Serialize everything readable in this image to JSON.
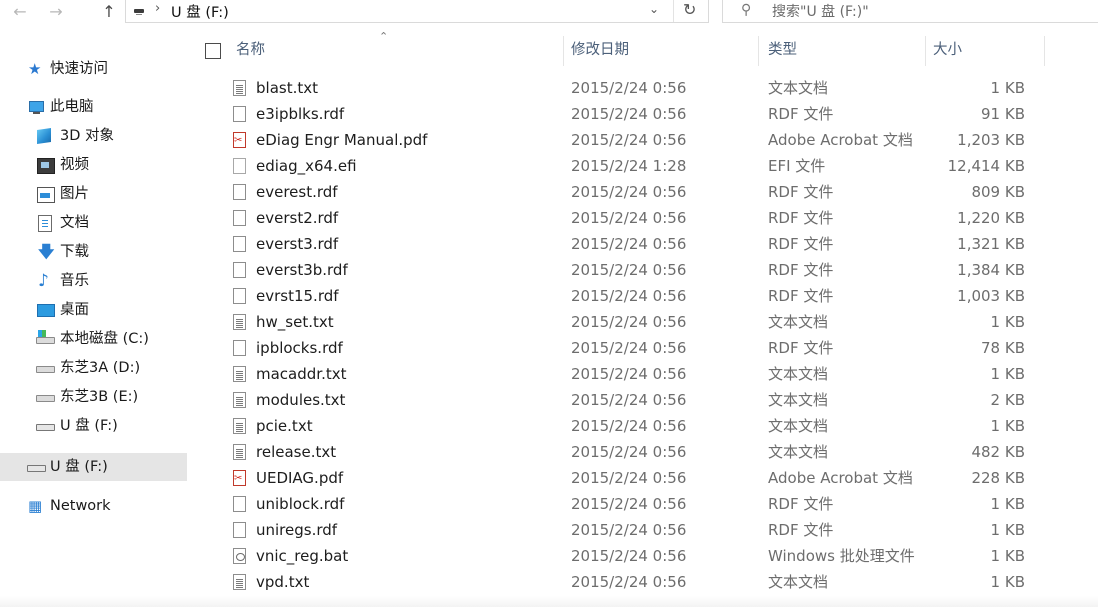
{
  "addressbar": {
    "back_icon": "arrow-left",
    "forward_icon": "arrow-right",
    "up_icon": "arrow-up",
    "separator": "›",
    "path": "U 盘 (F:)",
    "dropdown_icon": "chevron-down",
    "refresh_icon": "refresh"
  },
  "search": {
    "placeholder": "搜索\"U 盘 (F:)\"",
    "icon": "search"
  },
  "sidebar": {
    "quick_access": "快速访问",
    "this_pc": "此电脑",
    "items": [
      {
        "label": "3D 对象",
        "icon": "3d-objects"
      },
      {
        "label": "视频",
        "icon": "video"
      },
      {
        "label": "图片",
        "icon": "pictures"
      },
      {
        "label": "文档",
        "icon": "documents"
      },
      {
        "label": "下载",
        "icon": "downloads"
      },
      {
        "label": "音乐",
        "icon": "music"
      },
      {
        "label": "桌面",
        "icon": "desktop"
      },
      {
        "label": "本地磁盘 (C:)",
        "icon": "system-drive"
      },
      {
        "label": "东芝3A (D:)",
        "icon": "drive"
      },
      {
        "label": "东芝3B (E:)",
        "icon": "drive"
      },
      {
        "label": "U 盘 (F:)",
        "icon": "usb-drive"
      }
    ],
    "selected_drive": "U 盘 (F:)",
    "network": "Network"
  },
  "columns": {
    "name": "名称",
    "modified": "修改日期",
    "type": "类型",
    "size": "大小"
  },
  "files": [
    {
      "name": "blast.txt",
      "modified": "2015/2/24 0:56",
      "type": "文本文档",
      "size": "1 KB",
      "kind": "txt"
    },
    {
      "name": "e3ipblks.rdf",
      "modified": "2015/2/24 0:56",
      "type": "RDF 文件",
      "size": "91 KB",
      "kind": "rdf"
    },
    {
      "name": "eDiag Engr Manual.pdf",
      "modified": "2015/2/24 0:56",
      "type": "Adobe Acrobat 文档",
      "size": "1,203 KB",
      "kind": "pdf"
    },
    {
      "name": "ediag_x64.efi",
      "modified": "2015/2/24 1:28",
      "type": "EFI 文件",
      "size": "12,414 KB",
      "kind": "efi"
    },
    {
      "name": "everest.rdf",
      "modified": "2015/2/24 0:56",
      "type": "RDF 文件",
      "size": "809 KB",
      "kind": "rdf"
    },
    {
      "name": "everst2.rdf",
      "modified": "2015/2/24 0:56",
      "type": "RDF 文件",
      "size": "1,220 KB",
      "kind": "rdf"
    },
    {
      "name": "everst3.rdf",
      "modified": "2015/2/24 0:56",
      "type": "RDF 文件",
      "size": "1,321 KB",
      "kind": "rdf"
    },
    {
      "name": "everst3b.rdf",
      "modified": "2015/2/24 0:56",
      "type": "RDF 文件",
      "size": "1,384 KB",
      "kind": "rdf"
    },
    {
      "name": "evrst15.rdf",
      "modified": "2015/2/24 0:56",
      "type": "RDF 文件",
      "size": "1,003 KB",
      "kind": "rdf"
    },
    {
      "name": "hw_set.txt",
      "modified": "2015/2/24 0:56",
      "type": "文本文档",
      "size": "1 KB",
      "kind": "txt"
    },
    {
      "name": "ipblocks.rdf",
      "modified": "2015/2/24 0:56",
      "type": "RDF 文件",
      "size": "78 KB",
      "kind": "rdf"
    },
    {
      "name": "macaddr.txt",
      "modified": "2015/2/24 0:56",
      "type": "文本文档",
      "size": "1 KB",
      "kind": "txt"
    },
    {
      "name": "modules.txt",
      "modified": "2015/2/24 0:56",
      "type": "文本文档",
      "size": "2 KB",
      "kind": "txt"
    },
    {
      "name": "pcie.txt",
      "modified": "2015/2/24 0:56",
      "type": "文本文档",
      "size": "1 KB",
      "kind": "txt"
    },
    {
      "name": "release.txt",
      "modified": "2015/2/24 0:56",
      "type": "文本文档",
      "size": "482 KB",
      "kind": "txt"
    },
    {
      "name": "UEDIAG.pdf",
      "modified": "2015/2/24 0:56",
      "type": "Adobe Acrobat 文档",
      "size": "228 KB",
      "kind": "pdf"
    },
    {
      "name": "uniblock.rdf",
      "modified": "2015/2/24 0:56",
      "type": "RDF 文件",
      "size": "1 KB",
      "kind": "rdf"
    },
    {
      "name": "uniregs.rdf",
      "modified": "2015/2/24 0:56",
      "type": "RDF 文件",
      "size": "1 KB",
      "kind": "rdf"
    },
    {
      "name": "vnic_reg.bat",
      "modified": "2015/2/24 0:56",
      "type": "Windows 批处理文件",
      "size": "1 KB",
      "kind": "bat"
    },
    {
      "name": "vpd.txt",
      "modified": "2015/2/24 0:56",
      "type": "文本文档",
      "size": "1 KB",
      "kind": "txt"
    }
  ]
}
